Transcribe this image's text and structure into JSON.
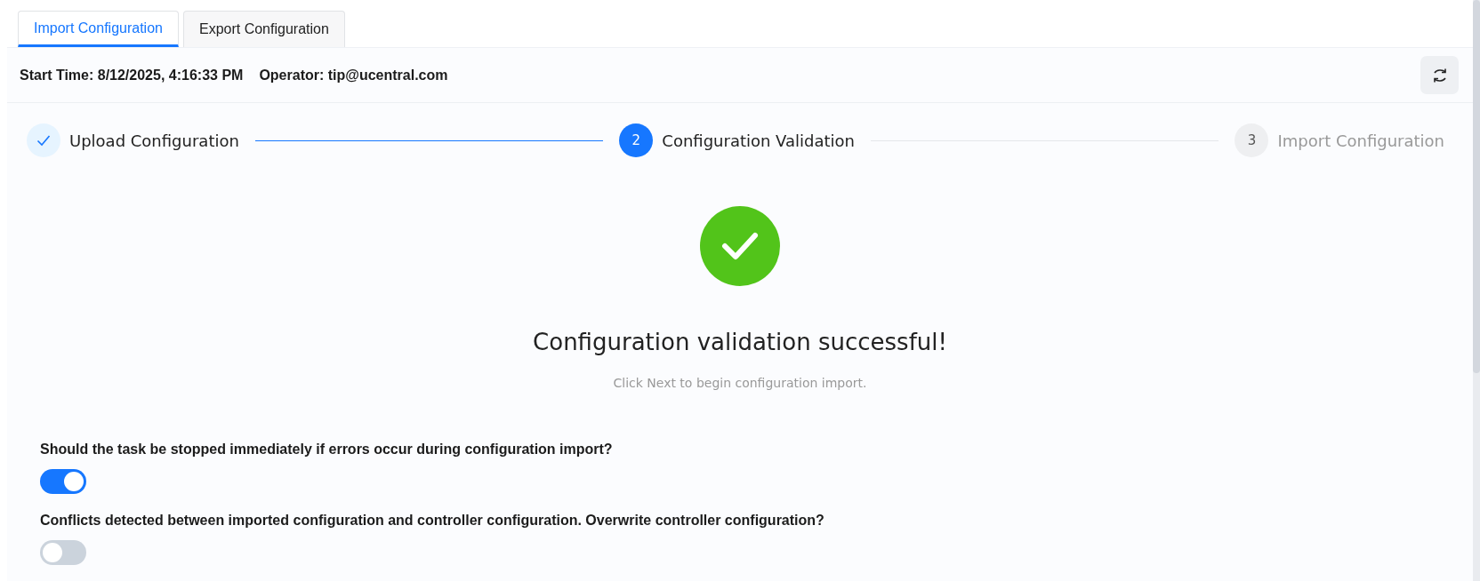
{
  "tabs": [
    {
      "label": "Import Configuration",
      "selected": true
    },
    {
      "label": "Export Configuration",
      "selected": false
    }
  ],
  "header": {
    "start_time": "Start Time: 8/12/2025, 4:16:33 PM",
    "operator": "Operator: tip@ucentral.com"
  },
  "steps": [
    {
      "kind": "done",
      "label": "Upload Configuration"
    },
    {
      "kind": "active",
      "number": "2",
      "label": "Configuration Validation"
    },
    {
      "kind": "pending",
      "number": "3",
      "label": "Import Configuration"
    }
  ],
  "result": {
    "title": "Configuration validation successful!",
    "subtitle": "Click Next to begin configuration import."
  },
  "options": [
    {
      "question": "Should the task be stopped immediately if errors occur during configuration import?",
      "on": true
    },
    {
      "question": "Conflicts detected between imported configuration and controller configuration. Overwrite controller configuration?",
      "on": false
    }
  ]
}
